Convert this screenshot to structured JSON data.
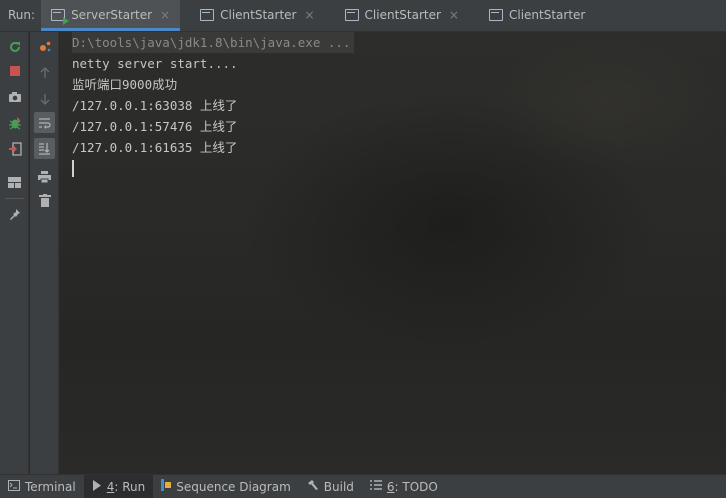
{
  "run_label": "Run:",
  "tabs": [
    {
      "label": "ServerStarter",
      "active": true,
      "running": true
    },
    {
      "label": "ClientStarter",
      "active": false,
      "running": false
    },
    {
      "label": "ClientStarter",
      "active": false,
      "running": false
    },
    {
      "label": "ClientStarter",
      "active": false,
      "running": false
    }
  ],
  "tab_close_glyph": "×",
  "console": {
    "command": "D:\\tools\\java\\jdk1.8\\bin\\java.exe ...",
    "lines": [
      "netty server start....",
      "监听端口9000成功",
      "/127.0.0.1:63038 上线了",
      "/127.0.0.1:57476 上线了",
      "/127.0.0.1:61635 上线了"
    ]
  },
  "bottom_bar": {
    "terminal": "Terminal",
    "run_key": "4",
    "run_label": ": Run",
    "sequence": "Sequence Diagram",
    "build": "Build",
    "todo_key": "6",
    "todo_label": ": TODO"
  },
  "colors": {
    "accent": "#4a88c7",
    "green": "#499c54",
    "red": "#c75450"
  }
}
